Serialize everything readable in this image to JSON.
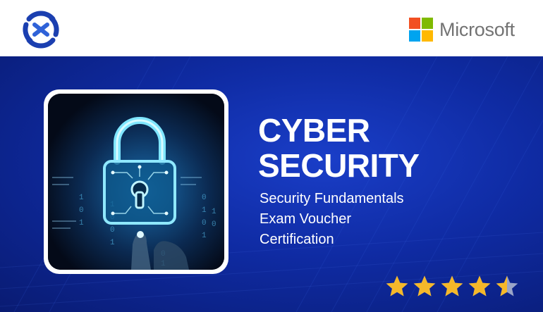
{
  "brand": {
    "logo_icon": "circular-swirl-logo-icon",
    "color": "#1b3fb0"
  },
  "partner": {
    "name": "Microsoft",
    "colors": [
      "#f25022",
      "#7fba00",
      "#00a4ef",
      "#ffb900"
    ]
  },
  "banner": {
    "background": "#1235b8",
    "image_icon": "padlock-circuit-icon",
    "title_lines": [
      "CYBER",
      "SECURITY"
    ],
    "subtitle_lines": [
      "Security Fundamentals",
      "Exam Voucher",
      "Certification"
    ]
  },
  "rating": {
    "value": 4.5,
    "max": 5,
    "star_color": "#f5b82a",
    "empty_color": "#9aa5c8"
  }
}
